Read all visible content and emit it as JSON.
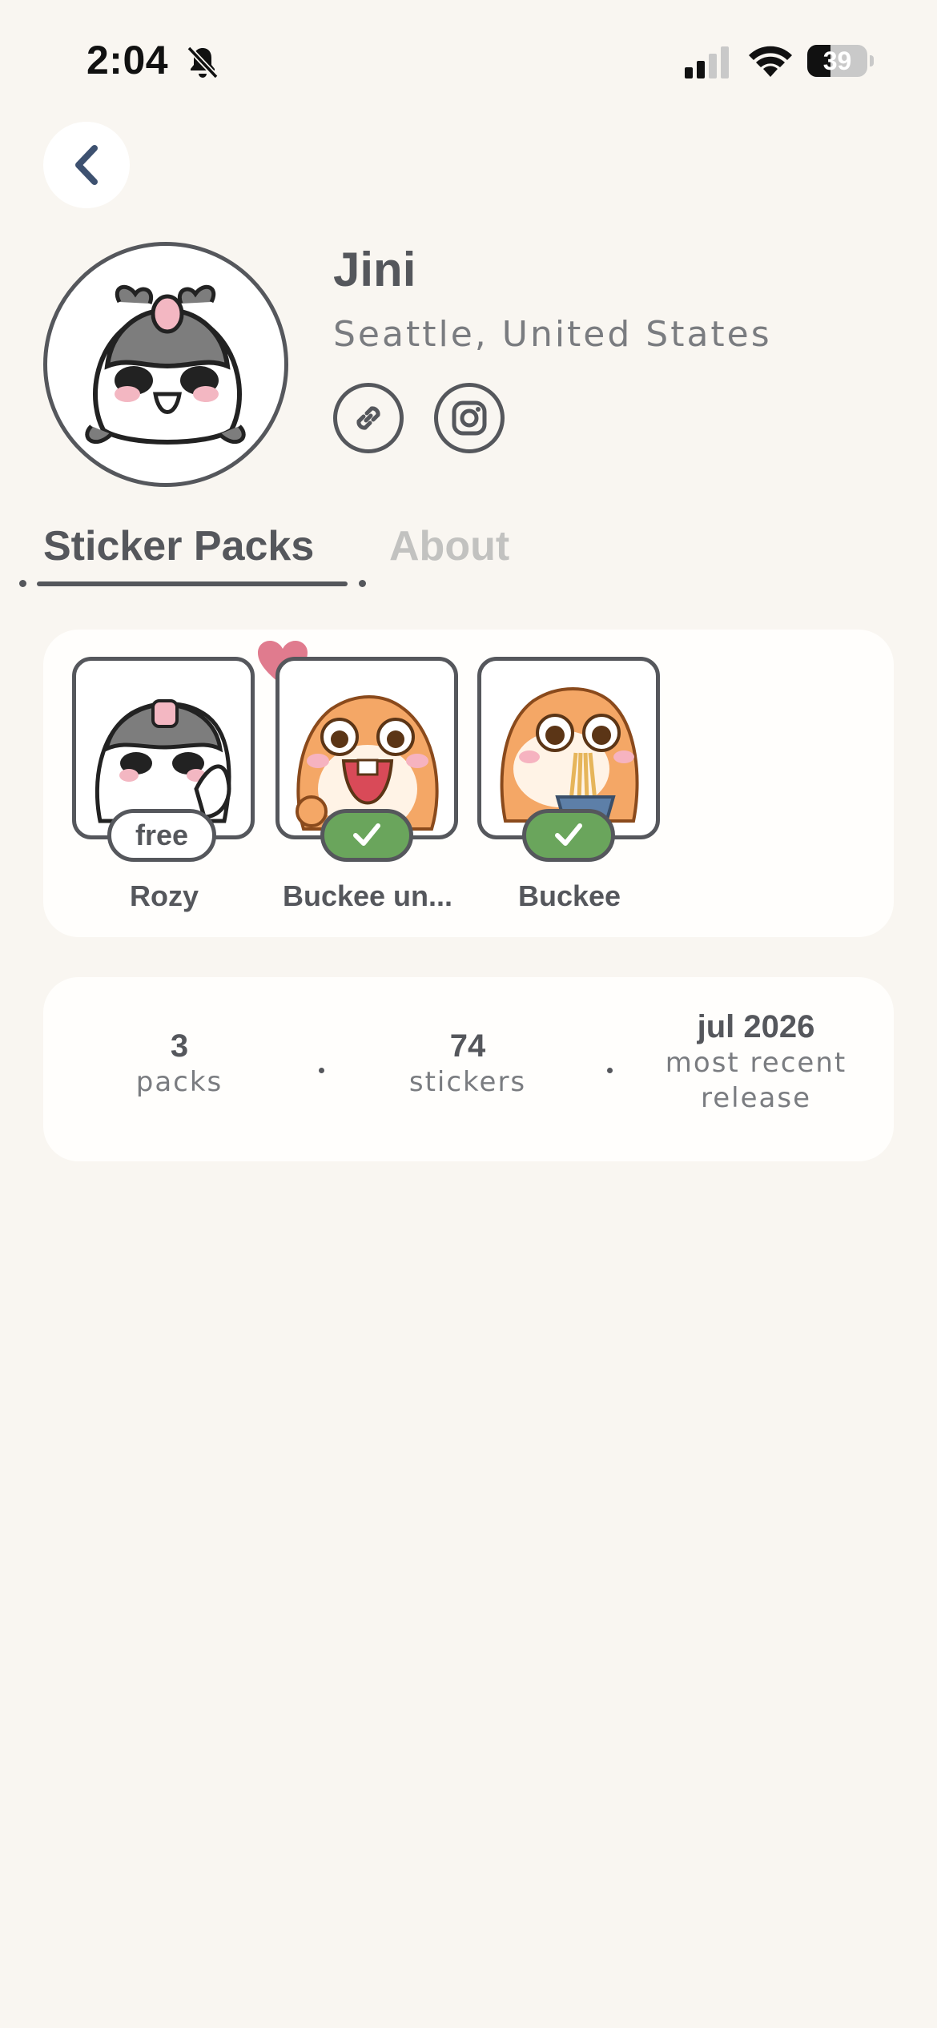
{
  "status_bar": {
    "time": "2:04",
    "battery": "39",
    "battery_level": 0.39
  },
  "profile": {
    "name": "Jini",
    "location": "Seattle, United States"
  },
  "tabs": [
    {
      "label": "Sticker Packs",
      "active": true
    },
    {
      "label": "About",
      "active": false
    }
  ],
  "packs": [
    {
      "name": "Rozy",
      "badge": "free",
      "favorited": true
    },
    {
      "name": "Buckee un...",
      "badge": "owned"
    },
    {
      "name": "Buckee",
      "badge": "owned"
    }
  ],
  "stats": [
    {
      "value": "3",
      "label": "packs"
    },
    {
      "value": "74",
      "label": "stickers"
    },
    {
      "value": "jul 2026",
      "label": "most recent release"
    }
  ],
  "colors": {
    "accent": "#55575c",
    "check_green": "#6aa55c",
    "heart_pink": "#e07b8e",
    "background": "#f9f6f1"
  },
  "icons": {
    "back": "chevron-left-icon",
    "link": "link-icon",
    "social": "instagram-icon",
    "silent": "bell-slash-icon"
  }
}
